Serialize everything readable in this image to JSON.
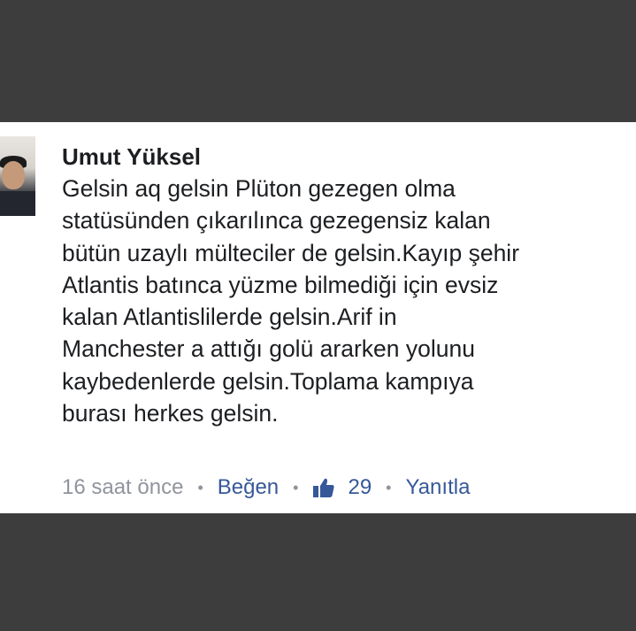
{
  "comment": {
    "author": "Umut Yüksel",
    "text": "Gelsin aq gelsin Plüton gezegen olma\nstatüsünden çıkarılınca gezegensiz kalan\nbütün uzaylı mülteciler de gelsin.Kayıp şehir\nAtlantis batınca yüzme bilmediği için evsiz\nkalan Atlantislilerde gelsin.Arif in\nManchester a attığı golü ararken yolunu\nkaybedenlerde gelsin.Toplama kampıya\nburası herkes gelsin.",
    "timestamp": "16 saat önce",
    "like_label": "Beğen",
    "like_count": "29",
    "reply_label": "Yanıtla"
  },
  "colors": {
    "text": "#1c1e21",
    "meta": "#90949c",
    "link": "#365899",
    "frame": "#3d3d3d"
  },
  "icons": {
    "avatar": "user-photo",
    "like": "thumbs-up-icon"
  }
}
